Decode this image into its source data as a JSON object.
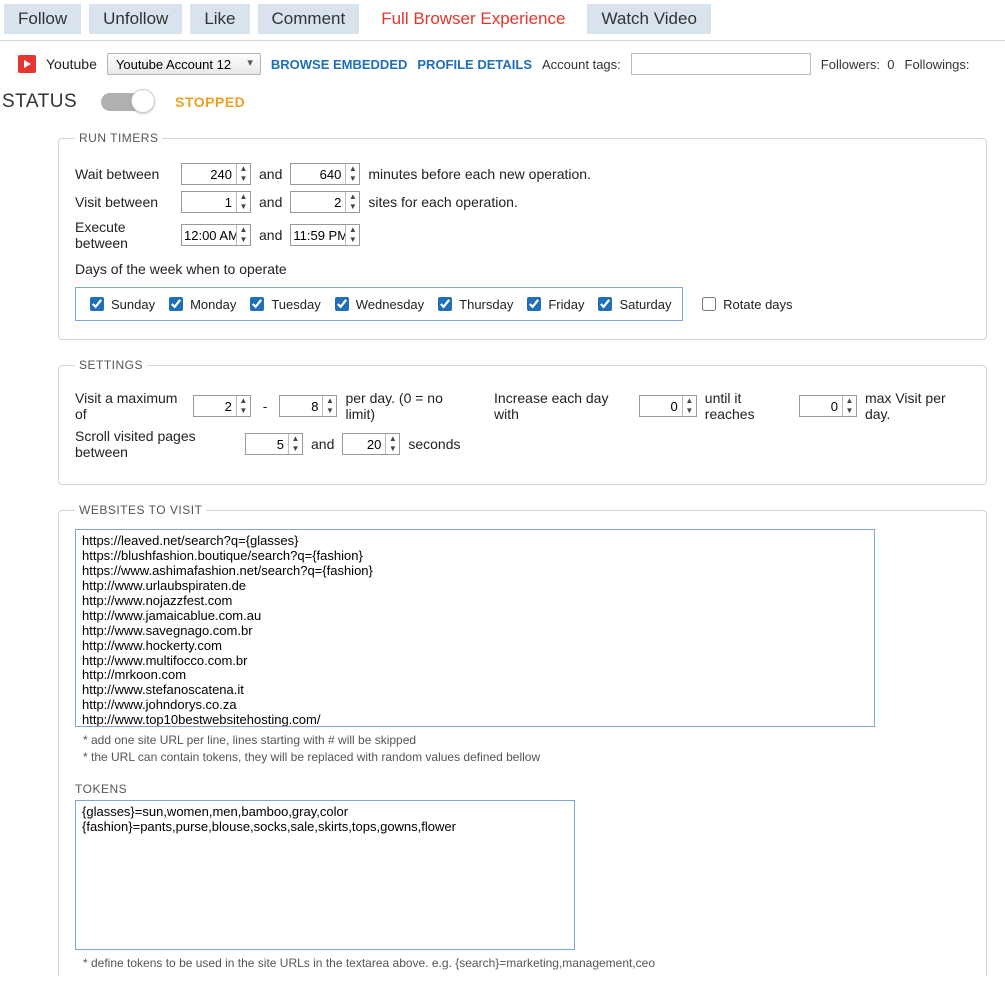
{
  "tabs": {
    "follow": "Follow",
    "unfollow": "Unfollow",
    "like": "Like",
    "comment": "Comment",
    "full_browser": "Full Browser Experience",
    "watch_video": "Watch Video"
  },
  "account": {
    "platform": "Youtube",
    "selected": "Youtube Account 12",
    "browse_embedded": "BROWSE EMBEDDED",
    "profile_details": "PROFILE DETAILS",
    "tags_label": "Account tags:",
    "tags_value": "",
    "followers_label": "Followers:",
    "followers_count": "0",
    "followings_label": "Followings:"
  },
  "status": {
    "label": "STATUS",
    "value": "STOPPED"
  },
  "run_timers": {
    "legend": "RUN TIMERS",
    "wait_label": "Wait between",
    "wait_min": "240",
    "wait_max": "640",
    "wait_suffix": "minutes before each new operation.",
    "and": "and",
    "visit_label": "Visit between",
    "visit_min": "1",
    "visit_max": "2",
    "visit_suffix": "sites for each operation.",
    "exec_label": "Execute between",
    "exec_from": "12:00 AM",
    "exec_to": "11:59 PM",
    "days_label": "Days of the week when to operate",
    "days": [
      "Sunday",
      "Monday",
      "Tuesday",
      "Wednesday",
      "Thursday",
      "Friday",
      "Saturday"
    ],
    "rotate": "Rotate days"
  },
  "settings": {
    "legend": "SETTINGS",
    "max_label": "Visit a maximum of",
    "max_min": "2",
    "max_max": "8",
    "perday": "per day. (0 = no limit)",
    "increase_label": "Increase each day with",
    "increase_val": "0",
    "until_label": "until it reaches",
    "until_val": "0",
    "max_suffix": "max Visit per day.",
    "scroll_label": "Scroll visited pages between",
    "scroll_min": "5",
    "scroll_max": "20",
    "seconds": "seconds",
    "sep": "-",
    "and": "and"
  },
  "websites": {
    "legend": "WEBSITES TO VISIT",
    "list": "https://leaved.net/search?q={glasses}\nhttps://blushfashion.boutique/search?q={fashion}\nhttps://www.ashimafashion.net/search?q={fashion}\nhttp://www.urlaubspiraten.de\nhttp://www.nojazzfest.com\nhttp://www.jamaicablue.com.au\nhttp://www.savegnago.com.br\nhttp://www.hockerty.com\nhttp://www.multifocco.com.br\nhttp://mrkoon.com\nhttp://www.stefanoscatena.it\nhttp://www.johndorys.co.za\nhttp://www.top10bestwebsitehosting.com/\nhttps://www.alibabacloud.com/",
    "hint1": "* add one site URL per line, lines starting with # will be skipped",
    "hint2": "* the URL can contain tokens, they will be replaced with random values defined bellow"
  },
  "tokens": {
    "legend": "TOKENS",
    "list": "{glasses}=sun,women,men,bamboo,gray,color\n{fashion}=pants,purse,blouse,socks,sale,skirts,tops,gowns,flower",
    "hint": "* define tokens to be used in the site URLs in the textarea above. e.g. {search}=marketing,management,ceo"
  }
}
